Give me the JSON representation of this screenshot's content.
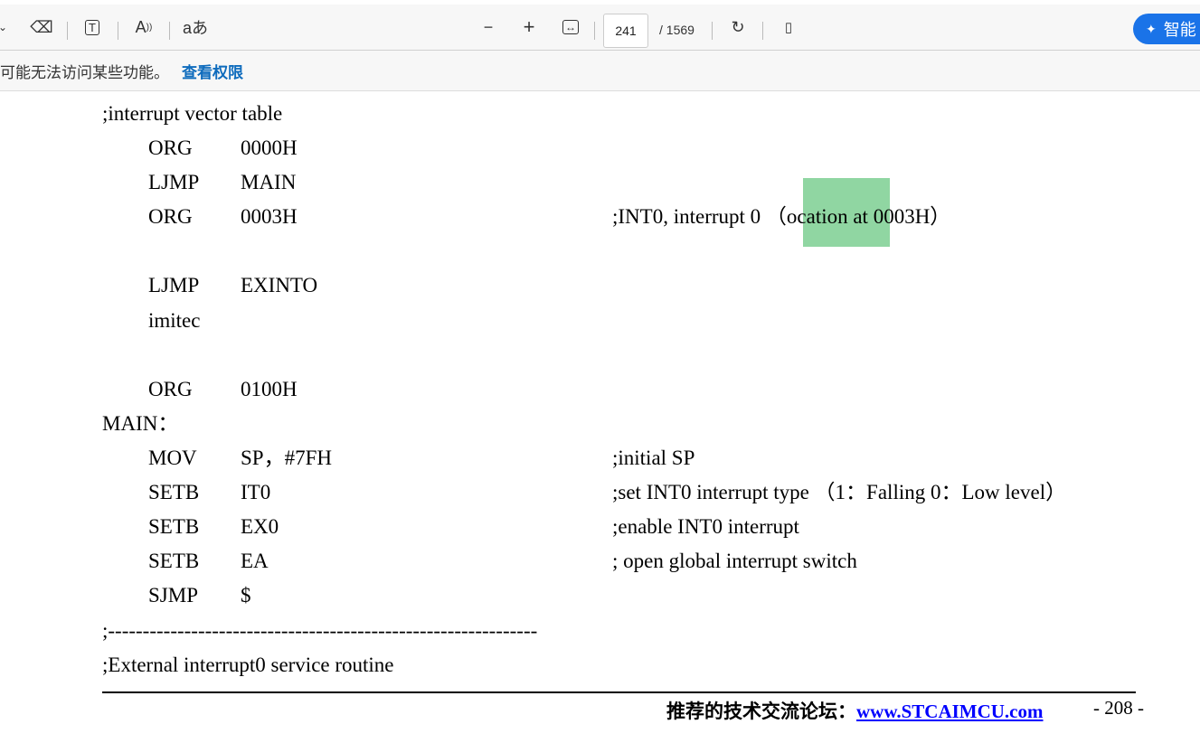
{
  "toolbar": {
    "page_current": "241",
    "page_total": "/ 1569",
    "ai_label": "智能",
    "zoom_out": "−",
    "zoom_in": "+"
  },
  "notice": {
    "text": "可能无法访问某些功能。",
    "link": "查看权限"
  },
  "code": [
    {
      "a": ";interrupt vector table",
      "b": "",
      "c": "",
      "d": ""
    },
    {
      "a": "",
      "b": "ORG",
      "c": "0000H",
      "d": ""
    },
    {
      "a": "",
      "b": "LJMP",
      "c": "MAIN",
      "d": ""
    },
    {
      "a": "",
      "b": "ORG",
      "c": "0003H",
      "d": ";INT0, interrupt 0 （ocation at 0003H）"
    },
    {
      "a": "",
      "b": "LJMP",
      "c": "EXINTO",
      "d": ""
    },
    {
      "a": "",
      "b": "imitec",
      "c": "",
      "d": ""
    },
    {
      "a": "",
      "b": "ORG",
      "c": "0100H",
      "d": ""
    },
    {
      "a": "MAIN：",
      "b": "",
      "c": "",
      "d": ""
    },
    {
      "a": "",
      "b": "MOV",
      "c": "SP，#7FH",
      "d": ";initial SP"
    },
    {
      "a": "",
      "b": "SETB",
      "c": "IT0",
      "d": ";set INT0 interrupt type （1：Falling 0：Low level）"
    },
    {
      "a": "",
      "b": "SETB",
      "c": "EX0",
      "d": ";enable INT0 interrupt"
    },
    {
      "a": "",
      "b": "SETB",
      "c": "EA",
      "d": "; open global interrupt switch"
    },
    {
      "a": "",
      "b": "SJMP",
      "c": "$",
      "d": ""
    },
    {
      "a": ";--------------------------------------------------------------",
      "b": "",
      "c": "",
      "d": ""
    },
    {
      "a": ";External interrupt0 service routine",
      "b": "",
      "c": "",
      "d": ""
    }
  ],
  "footer": {
    "forum": "推荐的技术交流论坛：",
    "url": "www.STCAIMCU.com",
    "page": "- 208 -"
  }
}
